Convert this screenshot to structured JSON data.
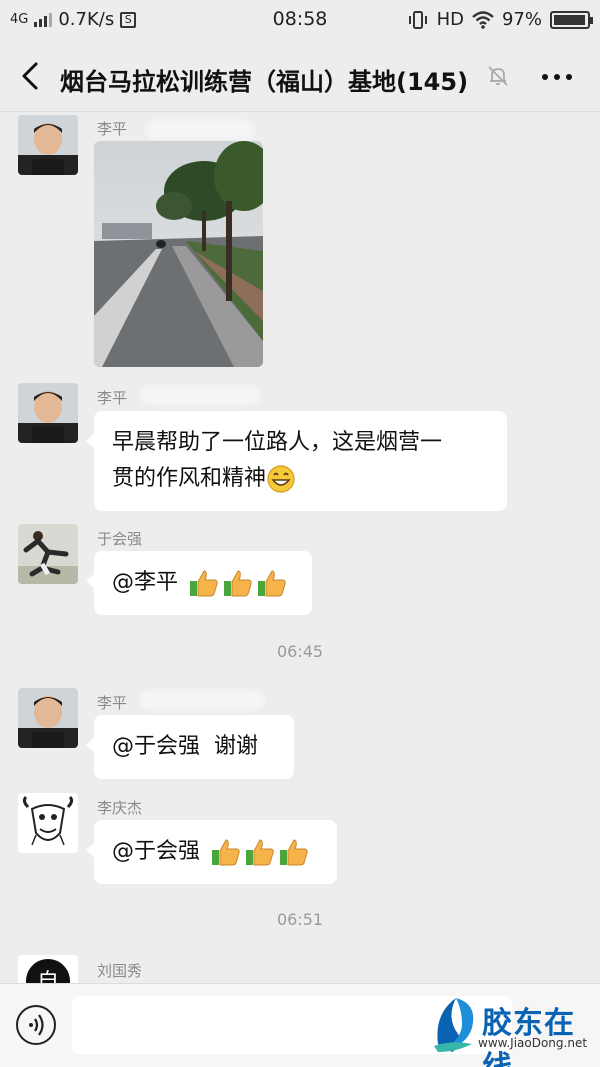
{
  "status_bar": {
    "network": "4G",
    "speed": "0.7K/s",
    "time": "08:58",
    "hd": "HD",
    "battery": "97%",
    "battery_level": 0.97
  },
  "header": {
    "title": "烟台马拉松训练营（福山）基地(145)"
  },
  "messages": [
    {
      "sender": "李平",
      "type": "image"
    },
    {
      "sender": "李平",
      "text_line1": "早晨帮助了一位路人，这是烟营一",
      "text_line2": "贯的作风和精神"
    },
    {
      "sender": "于会强",
      "text": "@李平"
    },
    {
      "sender": "李平",
      "text": "@于会强  谢谢"
    },
    {
      "sender": "李庆杰",
      "text": "@于会强"
    },
    {
      "sender": "刘国秀"
    }
  ],
  "timestamps": [
    "06:45",
    "06:51"
  ],
  "watermark": {
    "name": "胶东在线",
    "url": "www.JiaoDong.net"
  },
  "colors": {
    "background": "#ededed",
    "bubble": "#ffffff",
    "watermark_blue": "#0a62b3"
  }
}
